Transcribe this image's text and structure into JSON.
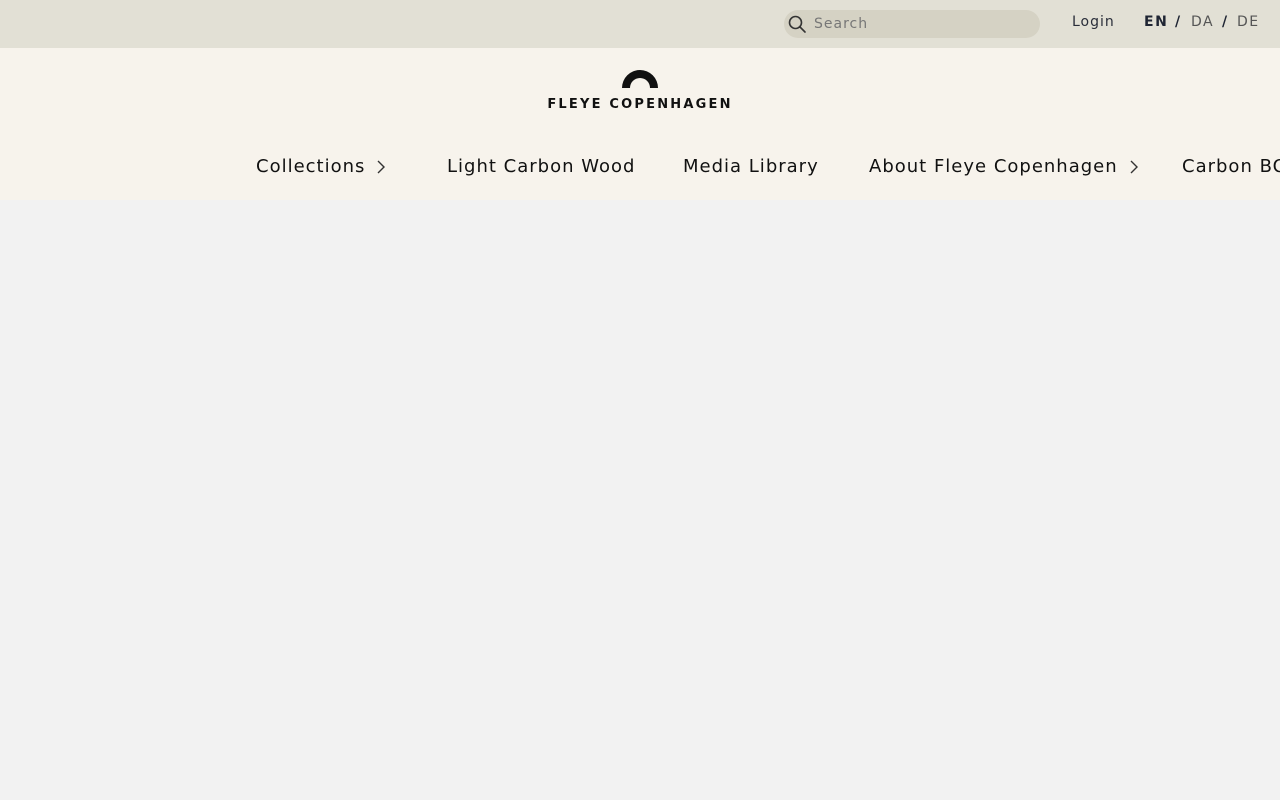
{
  "topbar": {
    "search_placeholder": "Search",
    "login_label": "Login",
    "languages": [
      {
        "code": "EN",
        "active": true
      },
      {
        "code": "DA",
        "active": false
      },
      {
        "code": "DE",
        "active": false
      }
    ],
    "separator": "/"
  },
  "header": {
    "logo_text": "FLEYE COPENHAGEN"
  },
  "nav": {
    "items": [
      {
        "label": "Collections",
        "has_submenu": true
      },
      {
        "label": "Light Carbon Wood",
        "has_submenu": false
      },
      {
        "label": "Media Library",
        "has_submenu": false
      },
      {
        "label": "About Fleye Copenhagen",
        "has_submenu": true
      },
      {
        "label": "Carbon BOI",
        "has_submenu": false
      }
    ]
  },
  "colors": {
    "topbar_bg": "#e2e0d5",
    "header_bg": "#f7f3ec",
    "page_bg": "#f2f2f2",
    "text_dark": "#111111"
  }
}
